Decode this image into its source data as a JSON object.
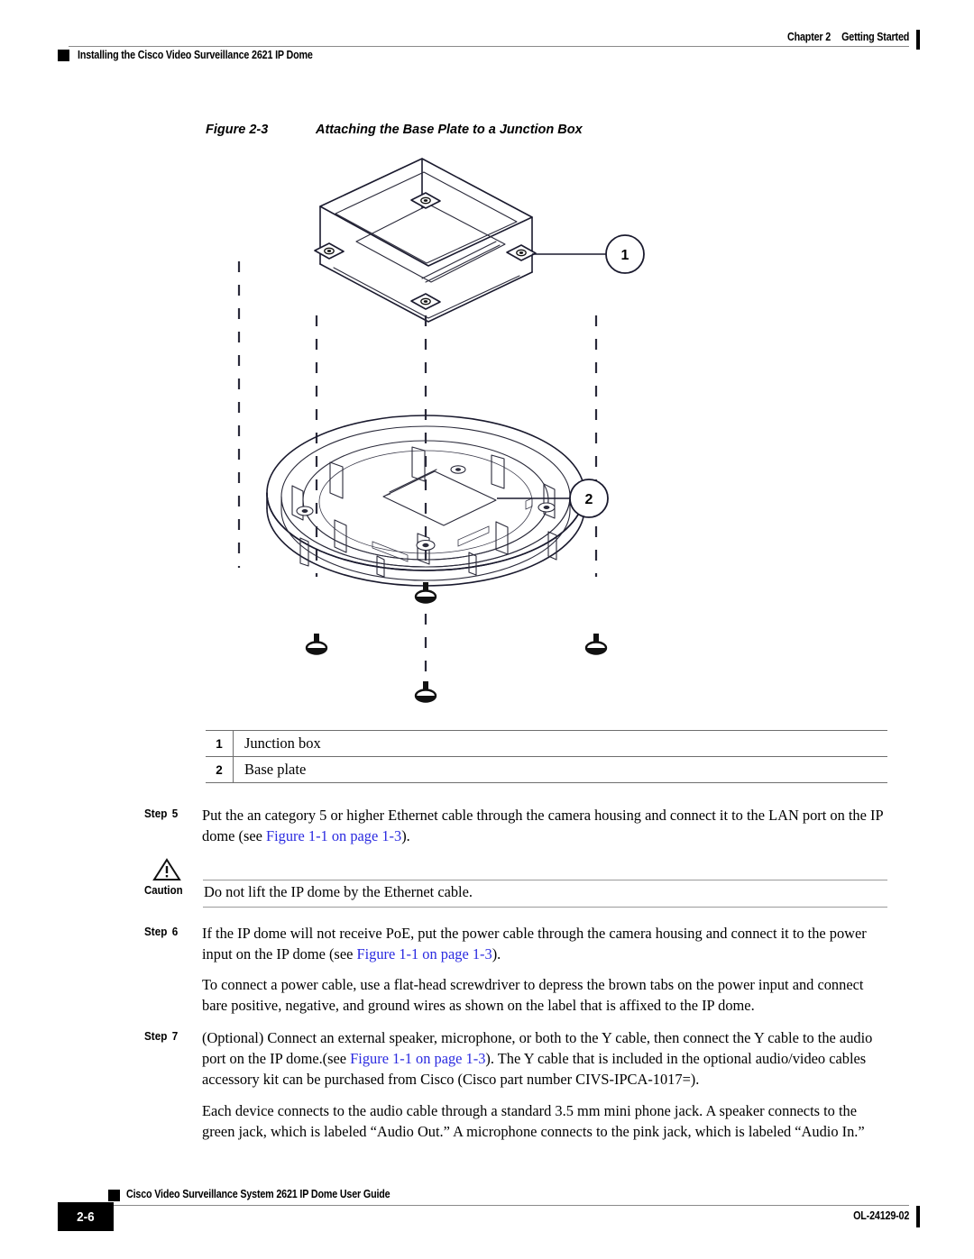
{
  "header": {
    "chapter": "Chapter 2",
    "chapter_title": "Getting Started",
    "running_title": "Installing the Cisco Video Surveillance 2621 IP Dome"
  },
  "figure": {
    "number": "Figure 2-3",
    "title": "Attaching the Base Plate to a Junction Box",
    "callouts": [
      {
        "id": "1",
        "label": "Junction box"
      },
      {
        "id": "2",
        "label": "Base plate"
      }
    ]
  },
  "legend": {
    "rows": [
      {
        "num": "1",
        "label": "Junction box"
      },
      {
        "num": "2",
        "label": "Base plate"
      }
    ]
  },
  "steps": [
    {
      "tag_word": "Step",
      "tag_num": "5",
      "paragraphs": [
        {
          "parts": [
            {
              "type": "text",
              "text": "Put the an category 5 or higher Ethernet cable through the camera housing and connect it to the LAN port on the IP dome (see "
            },
            {
              "type": "link",
              "text": "Figure 1-1 on page 1-3"
            },
            {
              "type": "text",
              "text": ")."
            }
          ]
        }
      ]
    },
    {
      "tag_word": "Step",
      "tag_num": "6",
      "paragraphs": [
        {
          "parts": [
            {
              "type": "text",
              "text": "If the IP dome will not receive PoE, put the power cable through the camera housing and connect it to the power input on the IP dome (see "
            },
            {
              "type": "link",
              "text": "Figure 1-1 on page 1-3"
            },
            {
              "type": "text",
              "text": ")."
            }
          ]
        },
        {
          "parts": [
            {
              "type": "text",
              "text": "To connect a power cable, use a flat-head screwdriver to depress the brown tabs on the power input and connect bare positive, negative, and ground wires as shown on the label that is affixed to the IP dome."
            }
          ]
        }
      ]
    },
    {
      "tag_word": "Step",
      "tag_num": "7",
      "paragraphs": [
        {
          "parts": [
            {
              "type": "text",
              "text": "(Optional) Connect an external speaker, microphone, or both to the Y cable, then connect the Y cable to the audio port on the IP dome.(see "
            },
            {
              "type": "link",
              "text": "Figure 1-1 on page 1-3"
            },
            {
              "type": "text",
              "text": "). The Y cable that is included in the optional audio/video cables accessory kit can be purchased from Cisco (Cisco part number CIVS-IPCA-1017=)."
            }
          ]
        },
        {
          "parts": [
            {
              "type": "text",
              "text": "Each device connects to the audio cable through a standard 3.5 mm mini phone jack. A speaker connects to the green jack, which is labeled “Audio Out.” A microphone connects to the pink jack, which is labeled “Audio In.”"
            }
          ]
        }
      ]
    }
  ],
  "caution": {
    "label": "Caution",
    "text": "Do not lift the IP dome by the Ethernet cable."
  },
  "footer": {
    "guide_title": "Cisco Video Surveillance System 2621 IP Dome User Guide",
    "page_number": "2-6",
    "doc_number": "OL-24129-02"
  },
  "colors": {
    "link": "#2a2ae0",
    "rule": "#8a8a8a",
    "ink": "#000000",
    "line_art": "#1a1a2e"
  }
}
